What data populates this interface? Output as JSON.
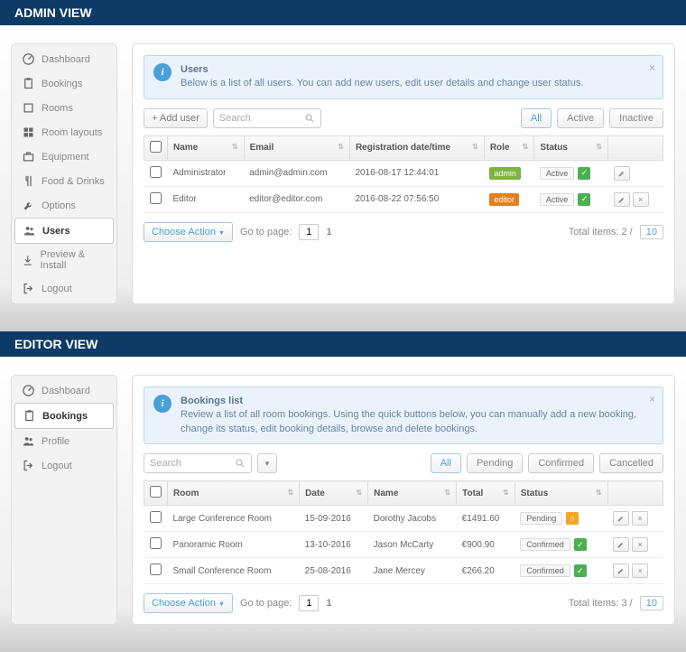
{
  "admin": {
    "header": "ADMIN VIEW",
    "sidebar": [
      {
        "label": "Dashboard",
        "icon": "gauge"
      },
      {
        "label": "Bookings",
        "icon": "clipboard"
      },
      {
        "label": "Rooms",
        "icon": "square"
      },
      {
        "label": "Room layouts",
        "icon": "layout"
      },
      {
        "label": "Equipment",
        "icon": "briefcase"
      },
      {
        "label": "Food & Drinks",
        "icon": "fork"
      },
      {
        "label": "Options",
        "icon": "wrench"
      },
      {
        "label": "Users",
        "icon": "users",
        "active": true
      },
      {
        "label": "Preview & Install",
        "icon": "download"
      },
      {
        "label": "Logout",
        "icon": "logout"
      }
    ],
    "info_title": "Users",
    "info_body": "Below is a list of all users. You can add new users, edit user details and change user status.",
    "add_btn": "+ Add user",
    "search_placeholder": "Search",
    "filters": [
      "All",
      "Active",
      "Inactive"
    ],
    "columns": [
      "Name",
      "Email",
      "Registration date/time",
      "Role",
      "Status",
      ""
    ],
    "rows": [
      {
        "name": "Administrator",
        "email": "admin@admin.com",
        "reg": "2016-08-17 12:44:01",
        "role": "admin",
        "role_class": "role-admin",
        "status": "Active",
        "actions": [
          "edit"
        ]
      },
      {
        "name": "Editor",
        "email": "editor@editor.com",
        "reg": "2016-08-22 07:56:50",
        "role": "editor",
        "role_class": "role-editor",
        "status": "Active",
        "actions": [
          "edit",
          "delete"
        ]
      }
    ],
    "choose_action": "Choose Action",
    "goto_label": "Go to page:",
    "page": "1",
    "page_count": "1",
    "total_label": "Total items:",
    "total": "2",
    "per_page": "10"
  },
  "editor": {
    "header": "EDITOR VIEW",
    "sidebar": [
      {
        "label": "Dashboard",
        "icon": "gauge"
      },
      {
        "label": "Bookings",
        "icon": "clipboard",
        "active": true
      },
      {
        "label": "Profile",
        "icon": "users"
      },
      {
        "label": "Logout",
        "icon": "logout"
      }
    ],
    "info_title": "Bookings list",
    "info_body": "Review a list of all room bookings. Using the quick buttons below, you can manually add a new booking, change its status, edit booking details, browse and delete bookings.",
    "search_placeholder": "Search",
    "filters": [
      "All",
      "Pending",
      "Confirmed",
      "Cancelled"
    ],
    "columns": [
      "Room",
      "Date",
      "Name",
      "Total",
      "Status",
      ""
    ],
    "rows": [
      {
        "room": "Large Conference Room",
        "date": "15-09-2016",
        "name": "Dorothy Jacobs",
        "total": "€1491.60",
        "status": "Pending",
        "status_type": "pending"
      },
      {
        "room": "Panoramic Room",
        "date": "13-10-2016",
        "name": "Jason McCarty",
        "total": "€900.90",
        "status": "Confirmed",
        "status_type": "confirmed"
      },
      {
        "room": "Small Conference Room",
        "date": "25-08-2016",
        "name": "Jane Mercey",
        "total": "€266.20",
        "status": "Confirmed",
        "status_type": "confirmed"
      }
    ],
    "choose_action": "Choose Action",
    "goto_label": "Go to page:",
    "page": "1",
    "page_count": "1",
    "total_label": "Total items:",
    "total": "3",
    "per_page": "10"
  }
}
